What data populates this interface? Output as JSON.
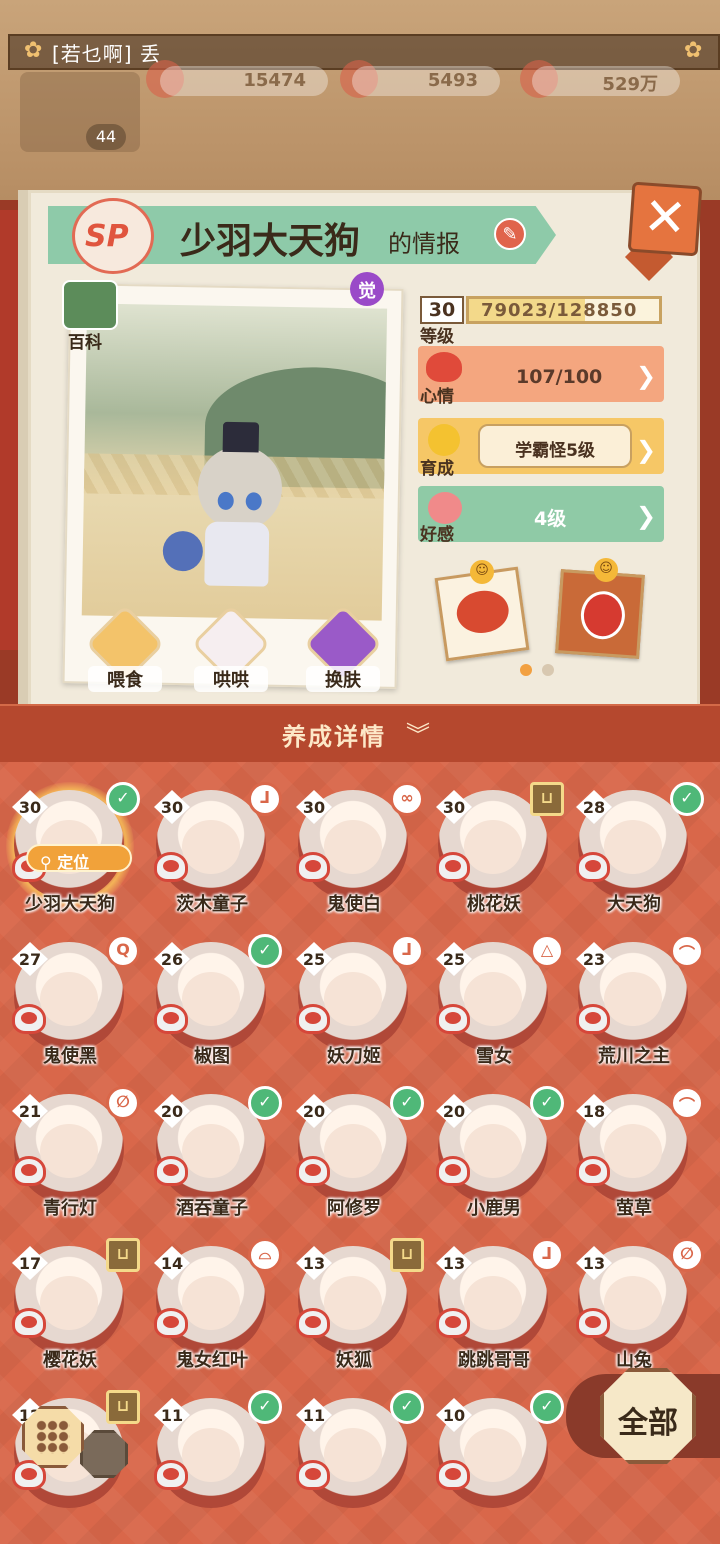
{
  "topbar": {
    "player_name": "[若乜啊] 丢",
    "level": "44",
    "resources": [
      "15474",
      "5493",
      "529万"
    ]
  },
  "info": {
    "rarity": "SP",
    "shikigami_name": "少羽大天狗",
    "title_suffix": "的情报",
    "encyclopedia_label": "百科",
    "awaken_label": "觉",
    "level": "30",
    "level_label": "等级",
    "exp_text": "79023/128850",
    "exp_fraction": 0.613,
    "mood_label": "心情",
    "mood_value": "107/100",
    "growth_label": "育成",
    "growth_value": "学霸怪5级",
    "affection_label": "好感",
    "affection_value": "4级",
    "actions": [
      {
        "label": "喂食",
        "color": "#f3c36a"
      },
      {
        "label": "哄哄",
        "color": "#f6eef0"
      },
      {
        "label": "换肤",
        "color": "#9a5ac8"
      }
    ]
  },
  "details_label": "养成详情",
  "roster": [
    {
      "level": "30",
      "name": "少羽大天狗",
      "tag": "check",
      "tag_text": "✓",
      "selected": true
    },
    {
      "level": "30",
      "name": "茨木童子",
      "tag": "ring",
      "tag_text": "ᒧ"
    },
    {
      "level": "30",
      "name": "鬼使白",
      "tag": "ring",
      "tag_text": "∞"
    },
    {
      "level": "30",
      "name": "桃花妖",
      "tag": "stand",
      "tag_text": "⊔"
    },
    {
      "level": "28",
      "name": "大天狗",
      "tag": "check",
      "tag_text": "✓"
    },
    {
      "level": "27",
      "name": "鬼使黑",
      "tag": "ring",
      "tag_text": "Q"
    },
    {
      "level": "26",
      "name": "椒图",
      "tag": "check",
      "tag_text": "✓"
    },
    {
      "level": "25",
      "name": "妖刀姬",
      "tag": "ring",
      "tag_text": "ᒧ"
    },
    {
      "level": "25",
      "name": "雪女",
      "tag": "ring",
      "tag_text": "△"
    },
    {
      "level": "23",
      "name": "荒川之主",
      "tag": "ring",
      "tag_text": "⌒"
    },
    {
      "level": "21",
      "name": "青行灯",
      "tag": "ring",
      "tag_text": "∅"
    },
    {
      "level": "20",
      "name": "酒吞童子",
      "tag": "check",
      "tag_text": "✓"
    },
    {
      "level": "20",
      "name": "阿修罗",
      "tag": "check",
      "tag_text": "✓"
    },
    {
      "level": "20",
      "name": "小鹿男",
      "tag": "check",
      "tag_text": "✓"
    },
    {
      "level": "18",
      "name": "萤草",
      "tag": "ring",
      "tag_text": "⌒"
    },
    {
      "level": "17",
      "name": "樱花妖",
      "tag": "stand",
      "tag_text": "⊔"
    },
    {
      "level": "14",
      "name": "鬼女红叶",
      "tag": "ring",
      "tag_text": "⌓"
    },
    {
      "level": "13",
      "name": "妖狐",
      "tag": "stand",
      "tag_text": "⊔"
    },
    {
      "level": "13",
      "name": "跳跳哥哥",
      "tag": "ring",
      "tag_text": "ᒧ"
    },
    {
      "level": "13",
      "name": "山兔",
      "tag": "ring",
      "tag_text": "∅"
    },
    {
      "level": "12",
      "name": "",
      "tag": "stand",
      "tag_text": "⊔"
    },
    {
      "level": "11",
      "name": "",
      "tag": "check",
      "tag_text": "✓"
    },
    {
      "level": "11",
      "name": "",
      "tag": "check",
      "tag_text": "✓"
    },
    {
      "level": "10",
      "name": "",
      "tag": "check",
      "tag_text": "✓"
    }
  ],
  "locate_label": "定位",
  "all_button": "全部"
}
